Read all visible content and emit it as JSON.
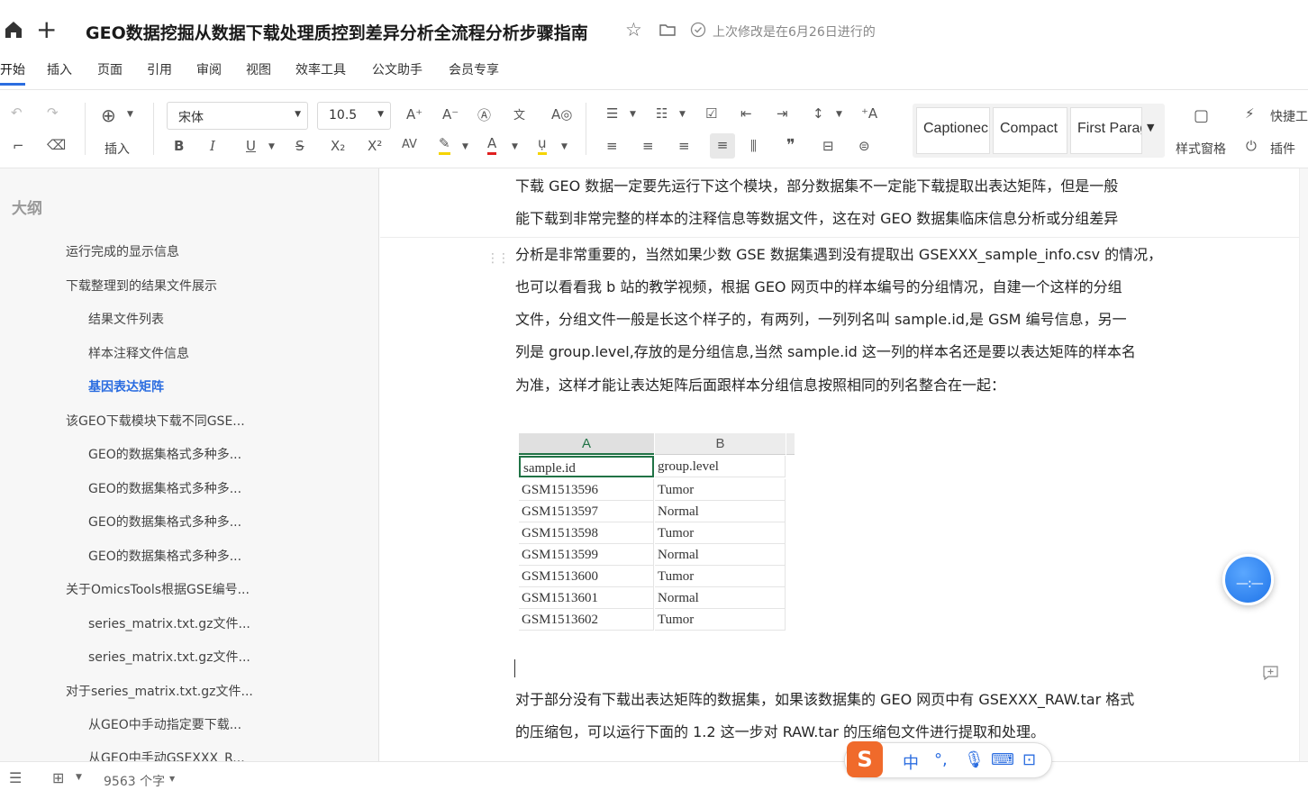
{
  "title_bar": {
    "doc_title": "GEO数据挖掘从数据下载处理质控到差异分析全流程分析步骤指南",
    "last_modified": "上次修改是在6月26日进行的"
  },
  "menu": [
    "开始",
    "插入",
    "页面",
    "引用",
    "审阅",
    "视图",
    "效率工具",
    "公文助手",
    "会员专享"
  ],
  "toolbar": {
    "insert_label": "插入",
    "font_name": "宋体",
    "font_size": "10.5",
    "styles": [
      "Captionec",
      "Compact",
      "First Parag"
    ],
    "style_pane_label": "样式窗格",
    "quick_tools_label": "快捷工",
    "plugins_label": "插件"
  },
  "outline": {
    "title": "大纲",
    "items": [
      "运行完成的显示信息",
      "下载整理到的结果文件展示",
      "结果文件列表",
      "样本注释文件信息",
      "基因表达矩阵",
      "该GEO下载模块下载不同GSE...",
      "GEO的数据集格式多种多...",
      "GEO的数据集格式多种多...",
      "GEO的数据集格式多种多...",
      "GEO的数据集格式多种多...",
      "关于OmicsTools根据GSE编号...",
      "series_matrix.txt.gz文件...",
      "series_matrix.txt.gz文件...",
      "对于series_matrix.txt.gz文件...",
      "从GEO中手动指定要下载...",
      "从GEO中手动GSEXXX_R..."
    ]
  },
  "document": {
    "paragraphs": [
      "下载 GEO 数据一定要先运行下这个模块，部分数据集不一定能下载提取出表达矩阵，但是一般",
      "能下载到非常完整的样本的注释信息等数据文件，这在对 GEO 数据集临床信息分析或分组差异",
      "分析是非常重要的，当然如果少数 GSE 数据集遇到没有提取出 GSEXXX_sample_info.csv 的情况，",
      "也可以看看我 b 站的教学视频，根据 GEO 网页中的样本编号的分组情况，自建一个这样的分组",
      "文件，分组文件一般是长这个样子的，有两列，一列列名叫 sample.id,是 GSM 编号信息，另一",
      "列是 group.level,存放的是分组信息,当然 sample.id 这一列的样本名还是要以表达矩阵的样本名",
      "为准，这样才能让表达矩阵后面跟样本分组信息按照相同的列名整合在一起：",
      "对于部分没有下载出表达矩阵的数据集，如果该数据集的 GEO 网页中有 GSEXXX_RAW.tar 格式",
      "的压缩包，可以运行下面的 1.2 这一步对 RAW.tar 的压缩包文件进行提取和处理。"
    ],
    "sheet": {
      "col_headers": [
        "A",
        "B"
      ],
      "rows": [
        [
          "sample.id",
          "group.level"
        ],
        [
          "GSM1513596",
          "Tumor"
        ],
        [
          "GSM1513597",
          "Normal"
        ],
        [
          "GSM1513598",
          "Tumor"
        ],
        [
          "GSM1513599",
          "Normal"
        ],
        [
          "GSM1513600",
          "Tumor"
        ],
        [
          "GSM1513601",
          "Normal"
        ],
        [
          "GSM1513602",
          "Tumor"
        ]
      ]
    }
  },
  "status_bar": {
    "word_count": "9563 个字"
  },
  "ime": {
    "logo": "S",
    "mode": "中",
    "punct": "°,"
  },
  "colors": {
    "accent": "#2b6de0",
    "sheet_selection": "#217346",
    "highlight_yellow": "#f5d400",
    "font_red": "#e02020"
  }
}
